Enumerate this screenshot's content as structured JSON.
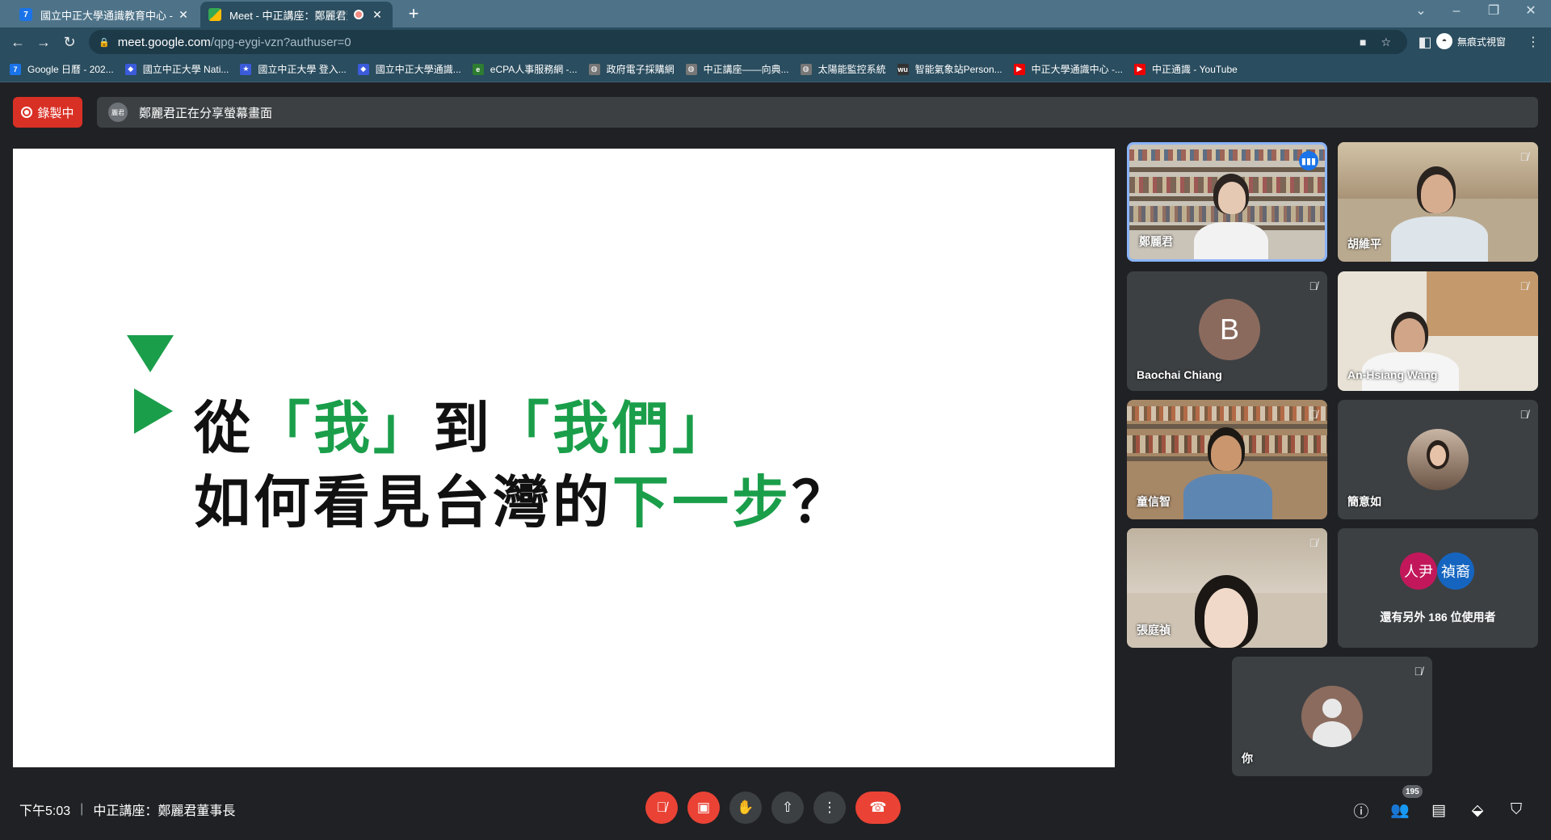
{
  "browser": {
    "tabs": [
      {
        "title": "國立中正大學通識教育中心 - 日曆",
        "favicon": "7"
      },
      {
        "title": "Meet - 中正講座：鄭麗君董",
        "favicon": ""
      }
    ],
    "new_tab": "+",
    "url_host": "meet.google.com",
    "url_path": "/qpg-eygi-vzn?authuser=0",
    "incognito_label": "無痕式視窗",
    "bookmarks": [
      {
        "label": "Google 日曆 - 202...",
        "icon": "7",
        "color": "#1a73e8"
      },
      {
        "label": "國立中正大學 Nati...",
        "icon": "◆",
        "color": "#3b5bdb"
      },
      {
        "label": "國立中正大學 登入...",
        "icon": "★",
        "color": "#3b5bdb"
      },
      {
        "label": "國立中正大學通識...",
        "icon": "◆",
        "color": "#3b5bdb"
      },
      {
        "label": "eCPA人事服務網 -...",
        "icon": "e",
        "color": "#2e7d32"
      },
      {
        "label": "政府電子採購網",
        "icon": "◍",
        "color": "#777"
      },
      {
        "label": "中正講座——向典...",
        "icon": "◍",
        "color": "#777"
      },
      {
        "label": "太陽能監控系統",
        "icon": "◍",
        "color": "#777"
      },
      {
        "label": "智能氣象站Person...",
        "icon": "wu",
        "color": "#333"
      },
      {
        "label": "中正大學通識中心 -...",
        "icon": "▶",
        "color": "#e00"
      },
      {
        "label": "中正通識 - YouTube",
        "icon": "▶",
        "color": "#e00"
      }
    ]
  },
  "meet": {
    "recording_label": "錄製中",
    "presenter_avatar": "麗君",
    "sharing_text": "鄭麗君正在分享螢幕畫面",
    "slide": {
      "line1_a": "從",
      "line1_b": "「我」",
      "line1_c": "到",
      "line1_d": "「我們」",
      "line2_a": "如何看見台灣的",
      "line2_b": "下一步",
      "line2_c": "？"
    },
    "participants": [
      {
        "name": "鄭麗君"
      },
      {
        "name": "胡維平"
      },
      {
        "name": "Baochai Chiang",
        "initial": "B"
      },
      {
        "name": "An-Hsiang Wang"
      },
      {
        "name": "童信智"
      },
      {
        "name": "簡意如"
      },
      {
        "name": "張庭禎"
      }
    ],
    "others": {
      "avatar1": "人尹",
      "avatar2": "禎裔",
      "text": "還有另外 186 位使用者"
    },
    "self_name": "你",
    "bottom": {
      "time": "下午5:03",
      "meeting_title": "中正講座：鄭麗君董事長",
      "people_count": "195"
    }
  }
}
